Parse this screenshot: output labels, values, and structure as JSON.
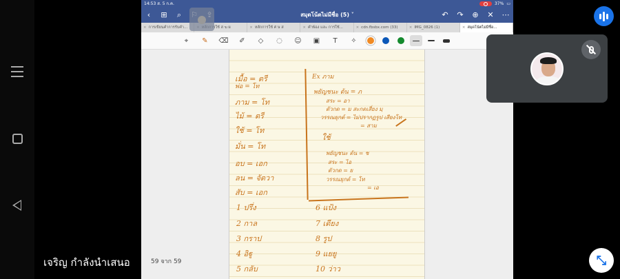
{
  "ipad": {
    "status": {
      "time": "14:53",
      "date": "ส. 5 ก.ค.",
      "battery": "37%"
    },
    "doc_title": "สมุดโน้ตไม่มีชื่อ (5) ˅",
    "tabs": [
      {
        "label": "การเขียนคำการรับคำ..."
      },
      {
        "label": "หลักการใช้ ส ฆ ผ"
      },
      {
        "label": "หลักการใช้ ศ ษ ส"
      },
      {
        "label": "คำพ้อง และ การใช้..."
      },
      {
        "label": "cdn.fbsbx.com (33)"
      },
      {
        "label": "IMG_0826 (1)"
      },
      {
        "label": "สมุดโน้ตไม่มีชื่อ...",
        "active": true
      }
    ],
    "colors": [
      "#f08a24",
      "#0b57b8",
      "#148a2e"
    ],
    "page_counter": "59 จาก 59"
  },
  "notes": {
    "left_col": [
      "เมื้อ  =  ตรี",
      "พ่อ  =  โท",
      "ภาม  =  โท",
      "ไม้  =  ตรี",
      "ใช้  =  โท",
      "มั่น  =  โท",
      "อบ  =  เอก",
      "ลน  =  จัตวา",
      "สับ  =  เอก"
    ],
    "right_col": [
      "Ex  ภาม",
      "พยัญชนะ ต้น = ภ",
      "สระ  =  อา",
      "ตัวกด  =  ม สะกดเสี่ยง  มฺ",
      "วรรณยุกต์  =  ไม่ปรากฏรูป  เสียงโท",
      "=  สาม",
      "ใช้",
      "พยัญชนะ  ต้น  =  ช",
      "สระ  =  ไอ",
      "ตัวกด  =  ย",
      "วรรณยุกต์  =  โท",
      "=  เอ"
    ],
    "numbered": [
      "1  ปรึ่ง",
      "2  กาล",
      "3  กราป",
      "4  อิฐู",
      "5  กลับ",
      "6  แป้ง",
      "7  เดียง",
      "8  รูป",
      "9  แยยู",
      "10  ว่าว"
    ]
  },
  "presenter_text": "เจริญ กำลังนำเสนอ"
}
